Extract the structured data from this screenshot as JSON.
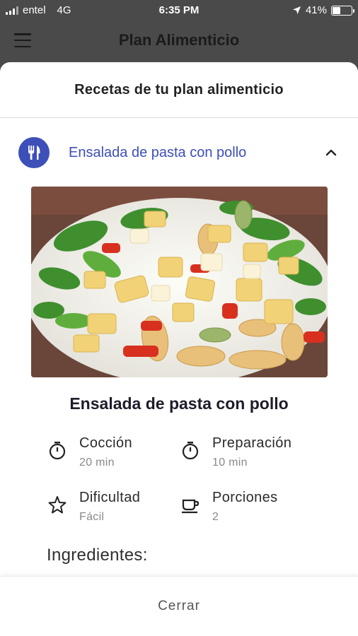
{
  "status_bar": {
    "carrier": "entel",
    "network": "4G",
    "time": "6:35 PM",
    "battery": "41%",
    "battery_level": 0.41
  },
  "app_bar": {
    "title": "Plan Alimenticio",
    "menu_icon": "hamburger-menu-icon"
  },
  "sheet": {
    "header": "Recetas de tu plan alimenticio",
    "recipe": {
      "name": "Ensalada de pasta con pollo",
      "badge_icon": "fork-knife-icon",
      "expand_icon": "chevron-up-icon"
    },
    "dish_title": "Ensalada de pasta con pollo",
    "info": {
      "coccion": {
        "label": "Cocción",
        "value": "20 min",
        "icon": "stopwatch-icon"
      },
      "preparacion": {
        "label": "Preparación",
        "value": "10 min",
        "icon": "stopwatch-icon"
      },
      "dificultad": {
        "label": "Dificultad",
        "value": "Fácil",
        "icon": "star-icon"
      },
      "porciones": {
        "label": "Porciones",
        "value": "2",
        "icon": "cup-icon"
      }
    },
    "ingredients_heading": "Ingredientes:",
    "footer_button": "Cerrar"
  },
  "colors": {
    "accent": "#3d4fb8",
    "overlay": "#4a4a4a"
  }
}
